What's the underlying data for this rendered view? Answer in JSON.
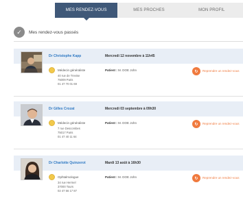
{
  "tabs": [
    {
      "label": "MES RENDEZ-VOUS",
      "active": true
    },
    {
      "label": "MES PROCHES",
      "active": false
    },
    {
      "label": "MON PROFIL",
      "active": false
    }
  ],
  "section": {
    "icon": "check-icon",
    "title": "Mes rendez-vous passés"
  },
  "appointments": [
    {
      "doctor": "Dr Christophe Kapp",
      "date": "Mercredi 12 novembre à 11h45",
      "specialty": "Médecin généraliste",
      "address_lines": [
        "40 rue de Trevise",
        "75009 Paris",
        "01 47 70 01 69"
      ],
      "patient_label": "Patient :",
      "patient_name": "M. DOE John",
      "rebook_label": "Reprendre un rendez-vous"
    },
    {
      "doctor": "Dr Gilles Crozat",
      "date": "Mercredi 03 septembre à 09h30",
      "specialty": "Médecin généraliste",
      "address_lines": [
        "7 rue Descombes",
        "75017 Paris",
        "01 47 40 11 64"
      ],
      "patient_label": "Patient :",
      "patient_name": "M. DOE John",
      "rebook_label": "Reprendre un rendez-vous"
    },
    {
      "doctor": "Dr Charlotte Quinzerot",
      "date": "Mardi 13 août à 16h30",
      "specialty": "Ophtalmologue",
      "address_lines": [
        "34 rue Hermel",
        "37000 Tours",
        "02 47 56 17 87"
      ],
      "patient_label": "Patient :",
      "patient_name": "M. DOE John",
      "rebook_label": "Reprendre un rendez-vous"
    }
  ],
  "colors": {
    "tab_active": "#3f5878",
    "band": "#e8eef6",
    "link": "#2f79c3",
    "accent": "#f07a3e",
    "specialty": "#f2c94c"
  }
}
